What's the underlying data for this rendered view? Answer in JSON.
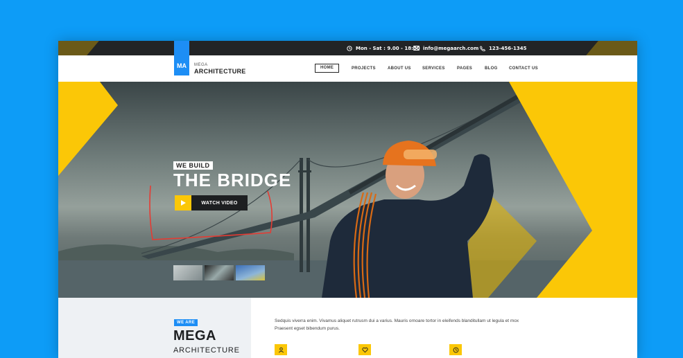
{
  "topbar": {
    "hours": "Mon - Sat : 9.00 - 18:00",
    "email": "info@megaarch.com",
    "phone": "123-456-1345"
  },
  "logo": {
    "initials": "MA",
    "small": "MEGA",
    "big": "ARCHITECTURE"
  },
  "menu": [
    "HOME",
    "PROJECTS",
    "ABOUT US",
    "SERVICES",
    "PAGES",
    "BLOG",
    "CONTACT US"
  ],
  "hero": {
    "kicker": "WE BUILD",
    "title": "THE BRIDGE",
    "button": "WATCH VIDEO"
  },
  "about": {
    "badge": "WE ARE",
    "title": "MEGA",
    "subtitle": "ARCHITECTURE",
    "paragraph": "Sedquis viverra enim. Vivamus aliquet rutrusm dui a varius. Mauris ornoare tortor in eleifends blanditullam ut legula et mox Praesent egset bibendum purus."
  },
  "colors": {
    "accent": "#fbc707",
    "brand": "#1d8ef5",
    "background": "#0d9cf7",
    "dark": "#1d1f21"
  },
  "icons": [
    "clock-icon",
    "mail-icon",
    "phone-icon",
    "play-icon",
    "user-icon",
    "heart-icon",
    "clock-icon"
  ]
}
